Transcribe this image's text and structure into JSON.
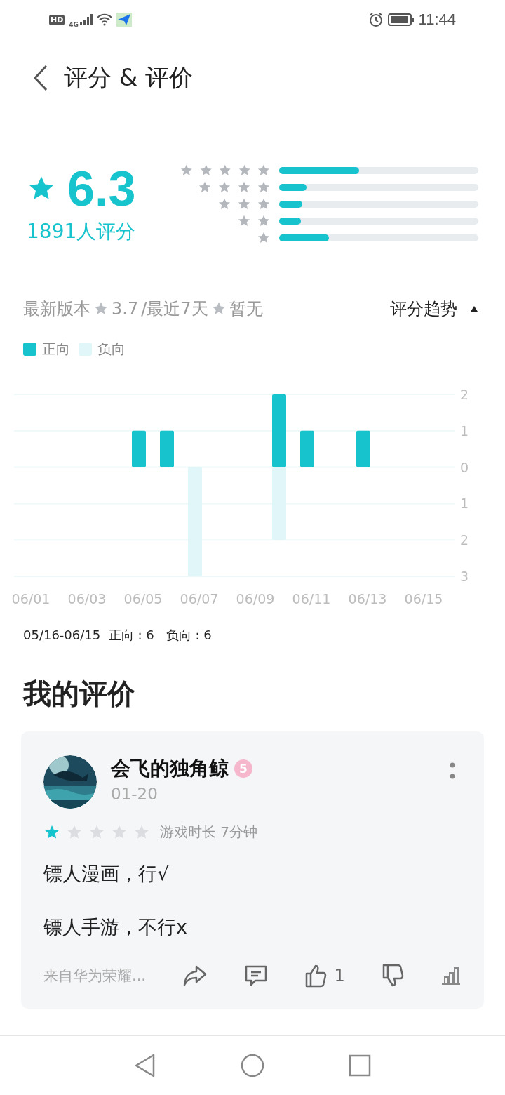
{
  "status_bar": {
    "hd": "HD",
    "network": "4G",
    "time": "11:44"
  },
  "header": {
    "title": "评分 & 评价"
  },
  "summary": {
    "score": "6.3",
    "count": "1891人评分",
    "distribution": [
      {
        "level": 0.4
      },
      {
        "level": 0.136
      },
      {
        "level": 0.115
      },
      {
        "level": 0.11
      },
      {
        "level": 0.25
      }
    ]
  },
  "version_line": {
    "label": "最新版本",
    "version_score": "3.7",
    "recent_label": "/最近7天",
    "recent_score": "暂无",
    "trend_button": "评分趋势"
  },
  "chart_data": {
    "type": "bar",
    "grid": true,
    "categories": [
      "06/01",
      null,
      "06/03",
      null,
      "06/05",
      null,
      "06/07",
      null,
      "06/09",
      null,
      "06/11",
      null,
      "06/13",
      null,
      "06/15"
    ],
    "series": [
      {
        "name": "正向",
        "color": "#17c3cc",
        "values": [
          0,
          0,
          0,
          0,
          1,
          1,
          0,
          0,
          0,
          2,
          1,
          0,
          1,
          0,
          0
        ]
      },
      {
        "name": "负向",
        "color": "#e0f6f8",
        "values": [
          0,
          0,
          0,
          0,
          0,
          0,
          -3,
          0,
          0,
          -2,
          0,
          0,
          0,
          0,
          0
        ]
      }
    ],
    "yticks": [
      2,
      1,
      0,
      {
        "value": -1,
        "label": "1"
      },
      {
        "value": -2,
        "label": "2"
      },
      {
        "value": -3,
        "label": "3"
      }
    ],
    "ylim": [
      -3,
      2
    ]
  },
  "period_summary": "05/16-06/15  正向 : 6   负向 : 6",
  "my_review": {
    "heading": "我的评价",
    "user": "会飞的独角鲸",
    "level_badge": "5",
    "date": "01-20",
    "stars": 1,
    "playtime": "游戏时长 7分钟",
    "paragraphs": [
      "镖人漫画，行√",
      "镖人手游，不行x"
    ],
    "device": "来自华为荣耀...",
    "likes": "1"
  }
}
